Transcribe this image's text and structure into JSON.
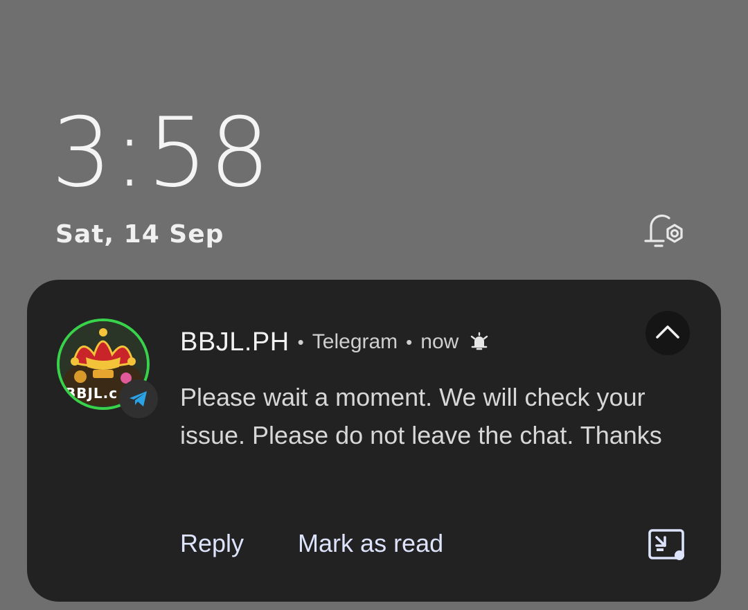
{
  "lockscreen": {
    "time": "3:58",
    "date": "Sat, 14 Sep",
    "notification_settings_icon": "bell-settings-icon"
  },
  "notification": {
    "sender": "BBJL.PH",
    "separator": "•",
    "app_name": "Telegram",
    "time": "now",
    "alert_icon": "bell-alert-icon",
    "avatar_text": "BBJL.c",
    "app_badge_icon": "telegram-icon",
    "message": "Please wait a moment. We will check your issue. Please do not leave the chat. Thanks",
    "collapse_icon": "chevron-up-icon",
    "actions": {
      "reply": "Reply",
      "mark_as_read": "Mark as read"
    },
    "popout_icon": "popout-window-icon",
    "colors": {
      "background": "#6f6f6f",
      "card": "#222222",
      "action_text": "#dde3fb",
      "telegram_blue": "#2aa3e6",
      "avatar_ring": "#39d24b"
    }
  }
}
